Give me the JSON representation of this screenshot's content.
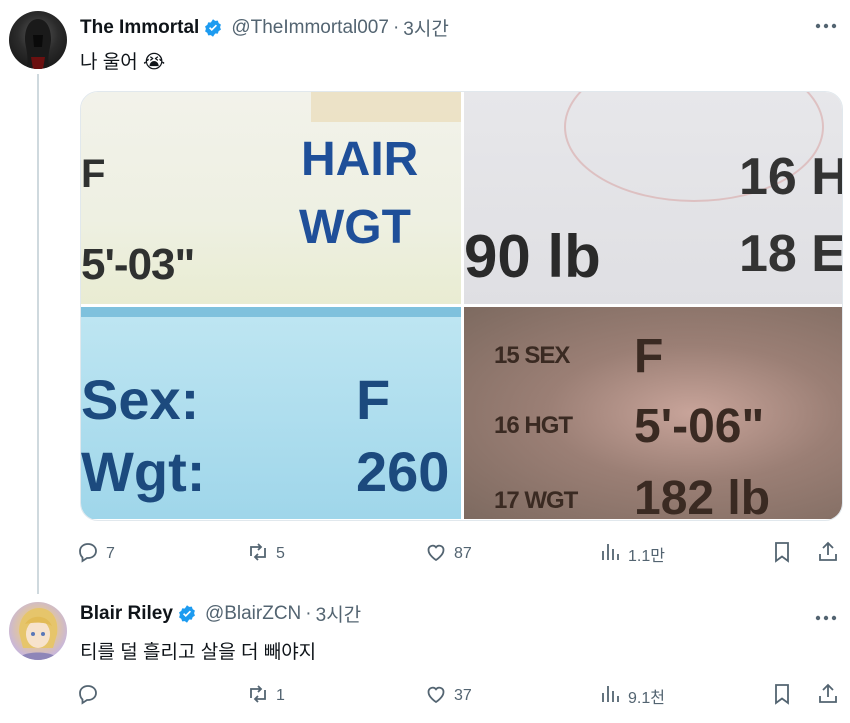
{
  "tweets": [
    {
      "name": "The Immortal",
      "handle": "@TheImmortal007",
      "separator": "·",
      "time": "3시간",
      "text": "나 울어 😭",
      "media": {
        "p1": [
          "F",
          "5'-03\"",
          "HAIR",
          "WGT"
        ],
        "p2": [
          "90 lb",
          "16 H",
          "18 E"
        ],
        "p3": [
          "Sex:",
          "Wgt:",
          "F",
          "260"
        ],
        "p4": [
          "15 SEX",
          "16 HGT",
          "17 WGT",
          "F",
          "5'-06\"",
          "182 lb"
        ]
      },
      "stats": {
        "replies": "7",
        "retweets": "5",
        "likes": "87",
        "views": "1.1만"
      }
    },
    {
      "name": "Blair Riley",
      "handle": "@BlairZCN",
      "separator": "·",
      "time": "3시간",
      "text": "티를 덜 흘리고 살을 더 빼야지",
      "stats": {
        "replies": "",
        "retweets": "1",
        "likes": "37",
        "views": "9.1천"
      }
    }
  ],
  "icons": {
    "verified": "verified-badge-icon",
    "more": "more-dots-icon",
    "reply": "reply-icon",
    "retweet": "retweet-icon",
    "like": "heart-icon",
    "views": "views-icon",
    "bookmark": "bookmark-icon",
    "share": "share-icon"
  },
  "colors": {
    "verified": "#1d9bf0",
    "secondary": "#536471",
    "thread_line": "#cfd9de"
  }
}
